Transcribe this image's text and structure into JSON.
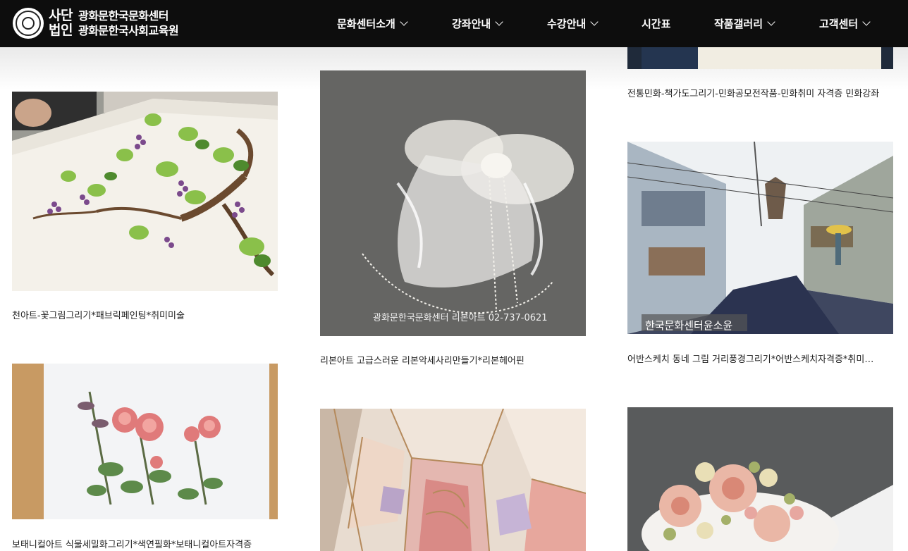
{
  "header": {
    "logo_badge_line1": "사단",
    "logo_badge_line2": "법인",
    "logo_name_line1": "광화문한국문화센터",
    "logo_name_line2": "광화문한국사회교육원",
    "nav": [
      {
        "label": "문화센터소개",
        "has_dropdown": true,
        "icon": "chevron-down-icon"
      },
      {
        "label": "강좌안내",
        "has_dropdown": true,
        "icon": "chevron-down-icon"
      },
      {
        "label": "수강안내",
        "has_dropdown": true,
        "icon": "chevron-down-icon"
      },
      {
        "label": "시간표",
        "has_dropdown": false
      },
      {
        "label": "작품갤러리",
        "has_dropdown": true,
        "icon": "chevron-down-icon"
      },
      {
        "label": "고객센터",
        "has_dropdown": true,
        "icon": "chevron-down-icon"
      }
    ]
  },
  "gallery": [
    {
      "caption": "천아트-꽃그림그리기*패브릭페인팅*취미미술"
    },
    {
      "caption": "리본아트 고급스러운 리본악세사리만들기*리본헤어핀",
      "image_text": "광화문한국문화센터 리본아트 02-737-0621"
    },
    {
      "caption": "전통민화-책가도그리기-민화공모전작품-민화취미 자격증 민화강좌"
    },
    {
      "caption": "어반스케치 동네 그림 거리풍경그리기*어반스케치자격증*취미미술",
      "image_text": "한국문화센터윤소윤"
    },
    {
      "caption": "보태니컬아트 식물세밀화그리기*색연필화*보태니컬아트자격증"
    },
    {
      "caption": ""
    },
    {
      "caption": ""
    }
  ],
  "colors": {
    "header_bg": "#0d0d0d",
    "nav_text": "#ffffff",
    "caption_text": "#222222",
    "page_bg": "#ffffff"
  }
}
